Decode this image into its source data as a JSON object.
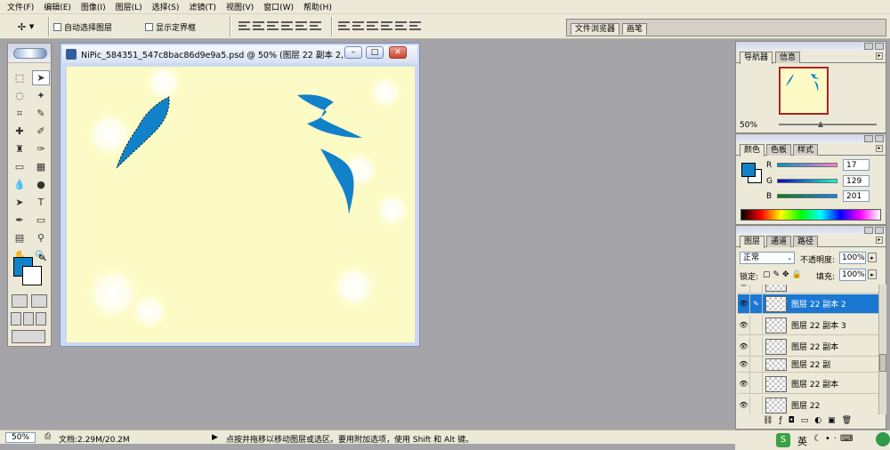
{
  "menu": [
    "文件(F)",
    "编辑(E)",
    "图像(I)",
    "图层(L)",
    "选择(S)",
    "滤镜(T)",
    "视图(V)",
    "窗口(W)",
    "帮助(H)"
  ],
  "options": {
    "auto_select_label": "自动选择图层",
    "show_bounds_label": "显示定界框",
    "well_tabs": [
      "文件浏览器",
      "画笔"
    ]
  },
  "document": {
    "title": "NiPic_584351_547c8bac86d9e9a5.psd @ 50% (图层 22 副本 2, ...",
    "background_color": "#fdfbc5",
    "shape_color": "#1182c9"
  },
  "navigator": {
    "tabs": [
      "导航器",
      "信息"
    ],
    "zoom": "50%"
  },
  "color_panel": {
    "tabs": [
      "颜色",
      "色板",
      "样式"
    ],
    "channels": [
      {
        "label": "R",
        "value": "17"
      },
      {
        "label": "G",
        "value": "129"
      },
      {
        "label": "B",
        "value": "201"
      }
    ],
    "foreground": "#1181c9"
  },
  "layers_panel": {
    "tabs": [
      "图层",
      "通道",
      "路径"
    ],
    "blend_mode": "正常",
    "opacity_label": "不透明度:",
    "opacity_value": "100%",
    "lock_label": "锁定:",
    "fill_label": "填充:",
    "fill_value": "100%",
    "layers": [
      {
        "name": "图层 22 副本 2",
        "selected": true
      },
      {
        "name": "图层 22 副本 3",
        "selected": false
      },
      {
        "name": "图层 22 副本",
        "selected": false
      },
      {
        "name": "图层 22 副",
        "selected": false
      },
      {
        "name": "图层 22 副本",
        "selected": false
      },
      {
        "name": "图层 22",
        "selected": false
      }
    ]
  },
  "status": {
    "zoom": "50%",
    "doc_info": "文档:2.29M/20.2M",
    "hint": "点按并拖移以移动图层或选区。要用附加选项，使用 Shift 和 Alt 键。"
  },
  "taskbar": {
    "ime": "英"
  }
}
